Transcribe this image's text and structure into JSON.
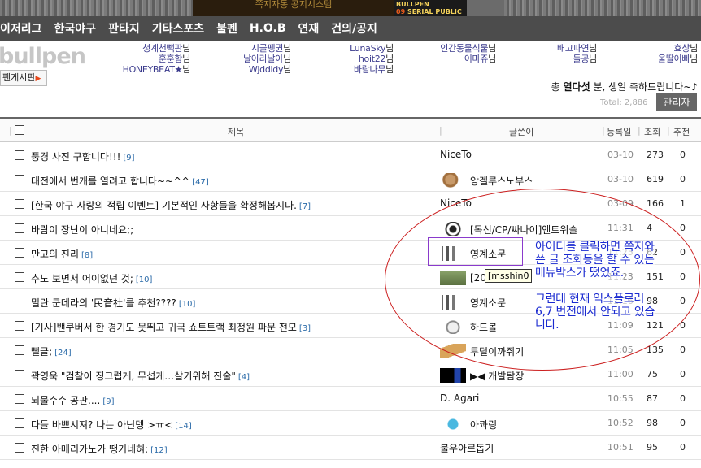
{
  "banner": {
    "promo_text": "쪽지자동 공지시스템",
    "sp_line1": "BULLPEN",
    "sp_line2_num": "09",
    "sp_line2": "SERIAL PUBLIC"
  },
  "nav": [
    "이저리그",
    "한국야구",
    "판타지",
    "기타스포츠",
    "불펜",
    "H.O.B",
    "연재",
    "건의/공지"
  ],
  "header": {
    "logo": "bullpen",
    "board_button": "펜게시판",
    "birthdays": [
      [
        "청계천빽판",
        "훈훈함",
        "HONEYBEAT★"
      ],
      [
        "시골펭귄",
        "날아라날아"
      ],
      [
        "Wjddidy"
      ],
      [
        "LunaSky",
        "hoit22",
        "바람나무"
      ],
      [
        "인간동물식물",
        "이마쥬"
      ],
      [
        "배고파연",
        "돌공"
      ],
      [
        "효상",
        "울딸이빠"
      ]
    ],
    "nim": "님",
    "celebrate_prefix": "총",
    "celebrate_count": "열다섯",
    "celebrate_suffix": "분, 생일 축하드립니다~♪",
    "total": "Total: 2,886",
    "admin_button": "관리자"
  },
  "table": {
    "headers": {
      "title": "제목",
      "writer": "글쓴이",
      "date": "등록일",
      "views": "조회",
      "rec": "추천"
    },
    "rows": [
      {
        "title": "풍경 사진 구합니다!!!",
        "comments": "[9]",
        "writer": "NiceTo",
        "avatar": "",
        "date": "03-10",
        "views": "273",
        "rec": "0"
      },
      {
        "title": "대전에서 번개를 열려고 합니다~~^^",
        "comments": "[47]",
        "writer": "앙겔루스노부스",
        "avatar": "dog",
        "date": "03-10",
        "views": "619",
        "rec": "0"
      },
      {
        "title": "[한국 야구 사랑의 적립 이벤트] 기본적인 사항들을 확정해봅시다.",
        "comments": "[7]",
        "writer": "NiceTo",
        "avatar": "",
        "date": "03-09",
        "views": "166",
        "rec": "1"
      },
      {
        "title": "바람이 장난이 아니네요;;",
        "comments": "",
        "writer": "[독신/CP/싸나이]엔트위슬",
        "avatar": "pie",
        "date": "11:31",
        "views": "4",
        "rec": "0"
      },
      {
        "title": "만고의 진리",
        "comments": "[8]",
        "writer": "영계소문",
        "avatar": "moo",
        "date": "11:25",
        "views": "62",
        "rec": "0"
      },
      {
        "title": "추노 보면서 어이없던 것;",
        "comments": "[10]",
        "writer": "[20",
        "avatar": "land",
        "date": "11:23",
        "views": "151",
        "rec": "0"
      },
      {
        "title": "밀란 쿤데라의 '民音社'를 추천????",
        "comments": "[10]",
        "writer": "영계소문",
        "avatar": "moo",
        "date": "11:16",
        "views": "98",
        "rec": "0"
      },
      {
        "title": "[기사]밴쿠버서 한 경기도 못뛰고 귀국 쇼트트랙 최정원 파문 전모",
        "comments": "[3]",
        "writer": "하드볼",
        "avatar": "face",
        "date": "11:09",
        "views": "121",
        "rec": "0"
      },
      {
        "title": "뻘글;",
        "comments": "[24]",
        "writer": "투덜이까쥐기",
        "avatar": "book",
        "date": "11:05",
        "views": "135",
        "rec": "0"
      },
      {
        "title": "곽영욱 \"검찰이 징그럽게, 무섭게…살기위해 진술\"",
        "comments": "[4]",
        "writer": "▶◀ 개발탐장",
        "avatar": "earth",
        "date": "11:00",
        "views": "75",
        "rec": "0"
      },
      {
        "title": "뇌물수수 공판....",
        "comments": "[9]",
        "writer": "D. Agari",
        "avatar": "",
        "date": "10:55",
        "views": "87",
        "rec": "0"
      },
      {
        "title": "다들 바쁘시져? 나는 아닌뎅 >ㅠ<",
        "comments": "[14]",
        "writer": "아콰링",
        "avatar": "drop",
        "date": "10:52",
        "views": "98",
        "rec": "0"
      },
      {
        "title": "진한 아메리카노가 땡기네혀;",
        "comments": "[12]",
        "writer": "불우아르돕기",
        "avatar": "",
        "date": "10:51",
        "views": "95",
        "rec": "0"
      }
    ],
    "tooltip": "[msshin0"
  },
  "annotation": {
    "line1": "아이디를 클릭하면 쪽지와",
    "line2": "쓴 글 조회등을 할 수 있는",
    "line3": "메뉴박스가 떴었죠.",
    "line4": "그런데 현재 익스플로러",
    "line5": "6,7 번전에서 안되고 있습",
    "line6": "니다."
  }
}
